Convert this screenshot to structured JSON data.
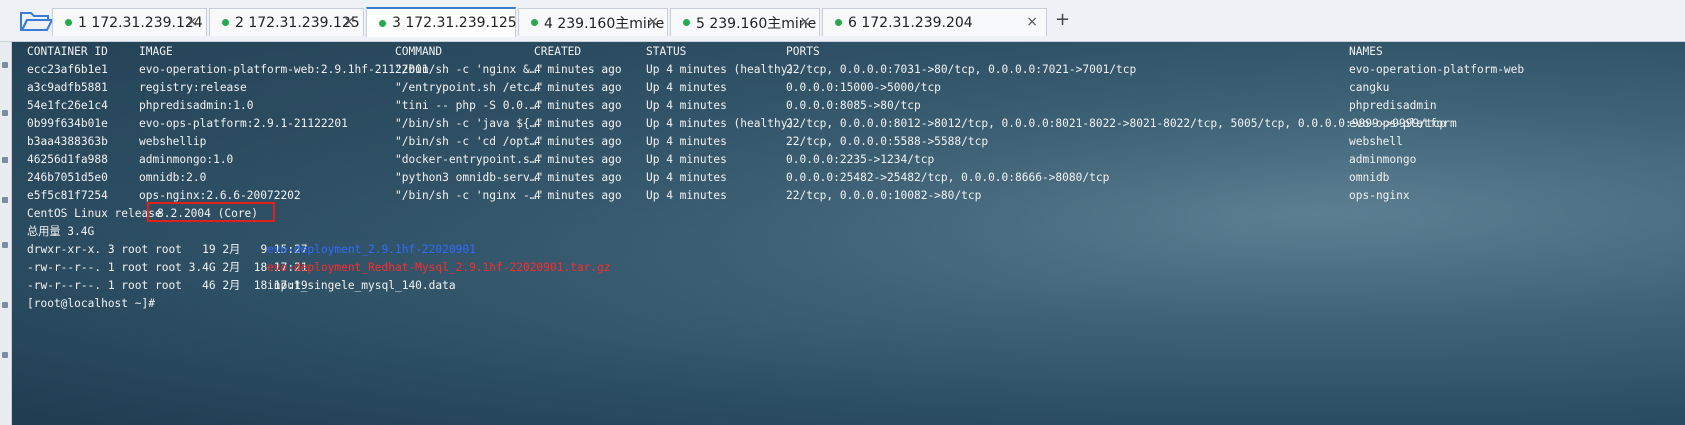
{
  "tabs": [
    {
      "label": "1 172.31.239.124",
      "active": false
    },
    {
      "label": "2 172.31.239.125",
      "active": false
    },
    {
      "label": "3 172.31.239.125",
      "active": true
    },
    {
      "label": "4 239.160主mine",
      "active": false
    },
    {
      "label": "5 239.160主mine",
      "active": false
    },
    {
      "label": "6 172.31.239.204",
      "active": false
    }
  ],
  "tab_close": "×",
  "add_tab": "+",
  "icons": {
    "folder": "folder-open-icon",
    "close": "close-icon",
    "add": "plus-icon",
    "status": "connected-dot-icon"
  },
  "colors": {
    "accent": "#3a7bd5",
    "connected": "#23a84a",
    "dir": "#2f6bff",
    "archive": "#ff2a2a",
    "highlight_box": "#e0201e"
  },
  "docker_header": {
    "id": "CONTAINER ID",
    "image": "IMAGE",
    "command": "COMMAND",
    "created": "CREATED",
    "status": "STATUS",
    "ports": "PORTS",
    "names": "NAMES"
  },
  "containers": [
    {
      "id": "ecc23af6b1e1",
      "image": "evo-operation-platform-web:2.9.1hf-21122001",
      "command": "\"/bin/sh -c 'nginx &…\"",
      "created": "4 minutes ago",
      "status": "Up 4 minutes (healthy)",
      "ports": "22/tcp, 0.0.0.0:7031->80/tcp, 0.0.0.0:7021->7001/tcp",
      "names": "evo-operation-platform-web"
    },
    {
      "id": "a3c9adfb5881",
      "image": "registry:release",
      "command": "\"/entrypoint.sh /etc…\"",
      "created": "4 minutes ago",
      "status": "Up 4 minutes",
      "ports": "0.0.0.0:15000->5000/tcp",
      "names": "cangku"
    },
    {
      "id": "54e1fc26e1c4",
      "image": "phpredisadmin:1.0",
      "command": "\"tini -- php -S 0.0.…\"",
      "created": "4 minutes ago",
      "status": "Up 4 minutes",
      "ports": "0.0.0.0:8085->80/tcp",
      "names": "phpredisadmin"
    },
    {
      "id": "0b99f634b01e",
      "image": "evo-ops-platform:2.9.1-21122201",
      "command": "\"/bin/sh -c 'java ${…\"",
      "created": "4 minutes ago",
      "status": "Up 4 minutes (healthy)",
      "ports": "22/tcp, 0.0.0.0:8012->8012/tcp, 0.0.0.0:8021-8022->8021-8022/tcp, 5005/tcp, 0.0.0.0:9999->9999/tcp",
      "names": "evo-ops-platform"
    },
    {
      "id": "b3aa4388363b",
      "image": "webshellip",
      "command": "\"/bin/sh -c 'cd /opt…\"",
      "created": "4 minutes ago",
      "status": "Up 4 minutes",
      "ports": "22/tcp, 0.0.0.0:5588->5588/tcp",
      "names": "webshell"
    },
    {
      "id": "46256d1fa988",
      "image": "adminmongo:1.0",
      "command": "\"docker-entrypoint.s…\"",
      "created": "4 minutes ago",
      "status": "Up 4 minutes",
      "ports": "0.0.0.0:2235->1234/tcp",
      "names": "adminmongo"
    },
    {
      "id": "246b7051d5e0",
      "image": "omnidb:2.0",
      "command": "\"python3 omnidb-serv…\"",
      "created": "4 minutes ago",
      "status": "Up 4 minutes",
      "ports": "0.0.0.0:25482->25482/tcp, 0.0.0.0:8666->8080/tcp",
      "names": "omnidb"
    },
    {
      "id": "e5f5c81f7254",
      "image": "ops-nginx:2.6.6-20072202",
      "command": "\"/bin/sh -c 'nginx -…\"",
      "created": "4 minutes ago",
      "status": "Up 4 minutes",
      "ports": "22/tcp, 0.0.0.0:10082->80/tcp",
      "names": "ops-nginx"
    }
  ],
  "release": {
    "prefix": "CentOS Linux release ",
    "version": "8.2.2004 (Core)"
  },
  "total": "总用量 3.4G",
  "files": [
    {
      "meta": "drwxr-xr-x. 3 root root   19 2月   9 15:27 ",
      "name": "evo-deployment_2.9.1hf-22020901",
      "kind": "dir"
    },
    {
      "meta": "-rw-r--r--. 1 root root 3.4G 2月  18 17:21 ",
      "name": "evo-deployment_Redhat-Mysql_2.9.1hf-22020901.tar.gz",
      "kind": "archive"
    },
    {
      "meta": "-rw-r--r--. 1 root root   46 2月  18 17:19 ",
      "name": "input_singele_mysql_140.data",
      "kind": "file"
    }
  ],
  "prompt": "[root@localhost ~]#"
}
